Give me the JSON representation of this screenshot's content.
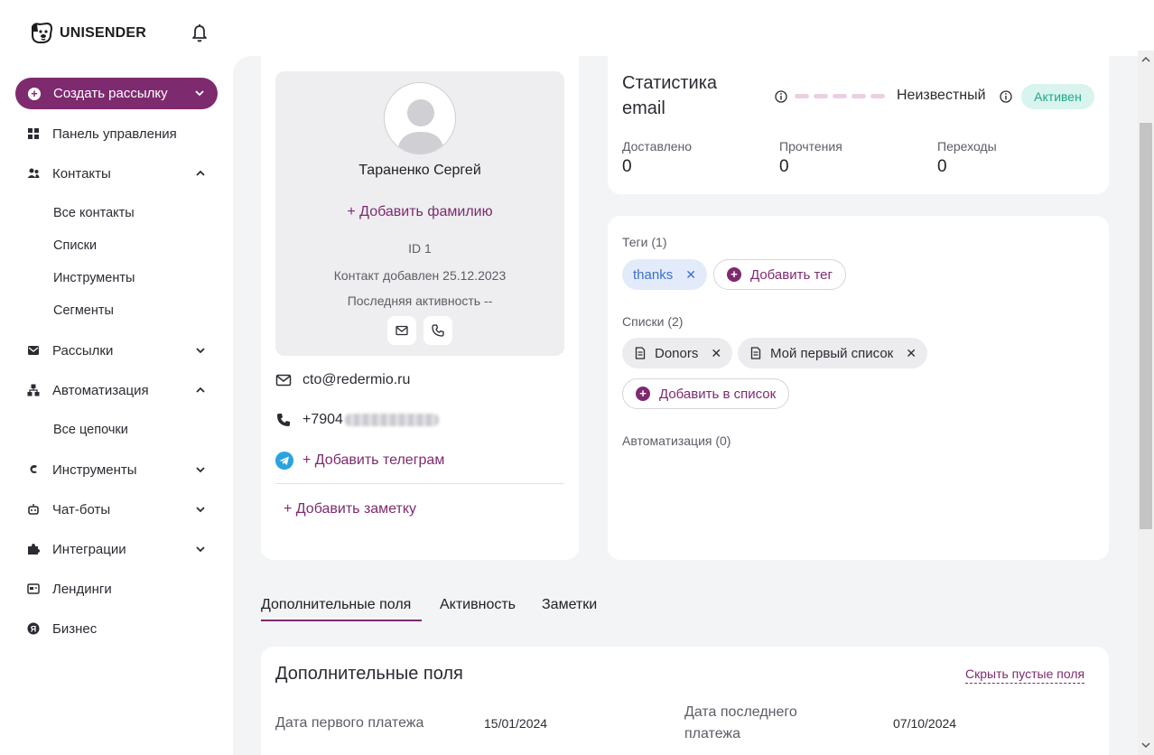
{
  "brand": {
    "name": "UNISENDER"
  },
  "sidebar": {
    "create_label": "Создать рассылку",
    "items": [
      {
        "label": "Панель управления",
        "icon": "dashboard-icon"
      },
      {
        "label": "Контакты",
        "icon": "contacts-icon",
        "expanded": true,
        "children": [
          "Все контакты",
          "Списки",
          "Инструменты",
          "Сегменты"
        ]
      },
      {
        "label": "Рассылки",
        "icon": "mailings-icon",
        "expanded": false
      },
      {
        "label": "Автоматизация",
        "icon": "automation-icon",
        "expanded": true,
        "children": [
          "Все цепочки"
        ]
      },
      {
        "label": "Инструменты",
        "icon": "tools-icon",
        "expanded": false
      },
      {
        "label": "Чат-боты",
        "icon": "chatbot-icon",
        "expanded": false
      },
      {
        "label": "Интеграции",
        "icon": "puzzle-icon",
        "expanded": false
      },
      {
        "label": "Лендинги",
        "icon": "landing-icon"
      },
      {
        "label": "Бизнес",
        "icon": "business-icon"
      }
    ]
  },
  "profile": {
    "name": "Тараненко Сергей",
    "add_surname": "+ Добавить фамилию",
    "id": "ID 1",
    "added": "Контакт добавлен 25.12.2023",
    "last_activity": "Последняя активность --",
    "email": "cto@redermio.ru",
    "phone_prefix": "+7904",
    "add_telegram": "+ Добавить телеграм",
    "add_note": "+ Добавить заметку"
  },
  "stats": {
    "title": "Статистика email",
    "status_text": "Неизвестный",
    "badge": "Активен",
    "metrics": [
      {
        "label": "Доставлено",
        "value": "0"
      },
      {
        "label": "Прочтения",
        "value": "0"
      },
      {
        "label": "Переходы",
        "value": "0"
      }
    ]
  },
  "tags_section": {
    "tags_label": "Теги (1)",
    "tags": [
      "thanks"
    ],
    "add_tag": "Добавить тег",
    "lists_label": "Списки (2)",
    "lists": [
      "Donors",
      "Мой первый список"
    ],
    "add_to_list": "Добавить в список",
    "automation_label": "Автоматизация (0)"
  },
  "tabs": [
    "Дополнительные поля",
    "Активность",
    "Заметки"
  ],
  "active_tab": 0,
  "extra": {
    "title": "Дополнительные поля",
    "hide_empty": "Скрыть пустые поля",
    "fields": [
      {
        "label": "Дата первого платежа",
        "value": "15/01/2024"
      },
      {
        "label": "Дата последнего платежа",
        "value": "07/10/2024"
      }
    ]
  },
  "colors": {
    "accent": "#7e2a6f",
    "active_badge_bg": "#d9f4ee",
    "active_badge_text": "#1ea885",
    "tag_bg": "#e3ebfa"
  }
}
